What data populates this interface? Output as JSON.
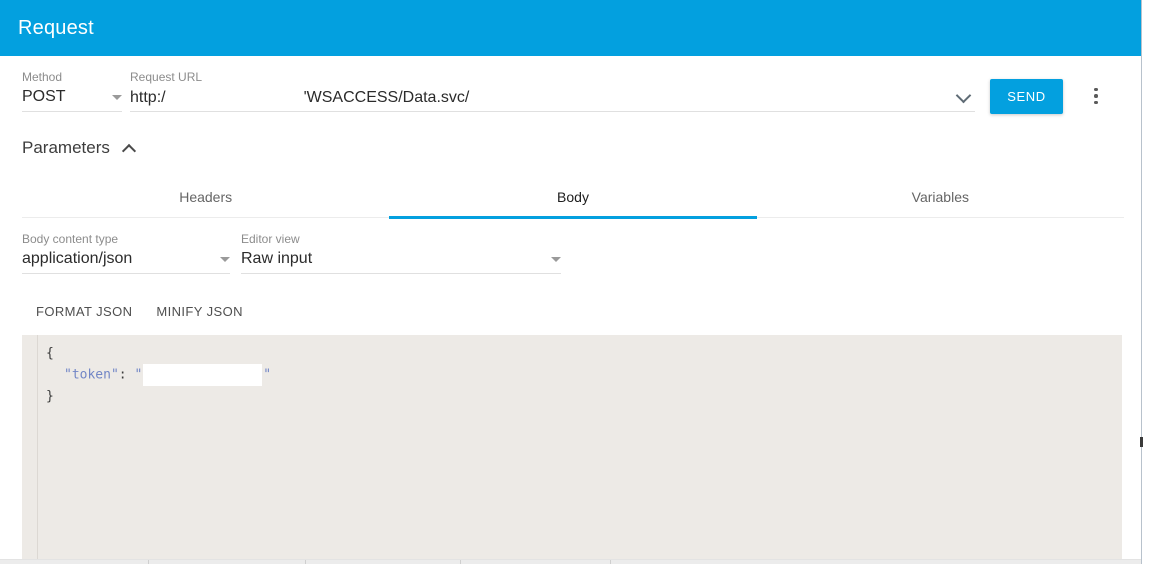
{
  "header": {
    "title": "Request",
    "accent_color": "#03a0df"
  },
  "request": {
    "method_label": "Method",
    "method_value": "POST",
    "url_label": "Request URL",
    "url_prefix": "http:/",
    "url_suffix": "'WSACCESS/Data.svc/",
    "url_redacted": true,
    "send_label": "SEND",
    "expand_icon": "chevron-down-icon",
    "more_icon": "kebab-menu-icon"
  },
  "parameters": {
    "label": "Parameters",
    "collapse_icon": "chevron-up-icon",
    "expanded": true
  },
  "tabs": [
    {
      "label": "Headers",
      "active": false
    },
    {
      "label": "Body",
      "active": true
    },
    {
      "label": "Variables",
      "active": false
    }
  ],
  "body_options": {
    "content_type_label": "Body content type",
    "content_type_value": "application/json",
    "editor_view_label": "Editor view",
    "editor_view_value": "Raw input"
  },
  "json_actions": {
    "format_label": "FORMAT JSON",
    "minify_label": "MINIFY JSON"
  },
  "editor": {
    "line_open": "{",
    "key": "\"token\"",
    "colon": ": ",
    "quote": "\"",
    "value_redacted": true,
    "line_close": "}"
  },
  "bottom_table": {
    "divider_positions": [
      148,
      305,
      460,
      610
    ]
  }
}
